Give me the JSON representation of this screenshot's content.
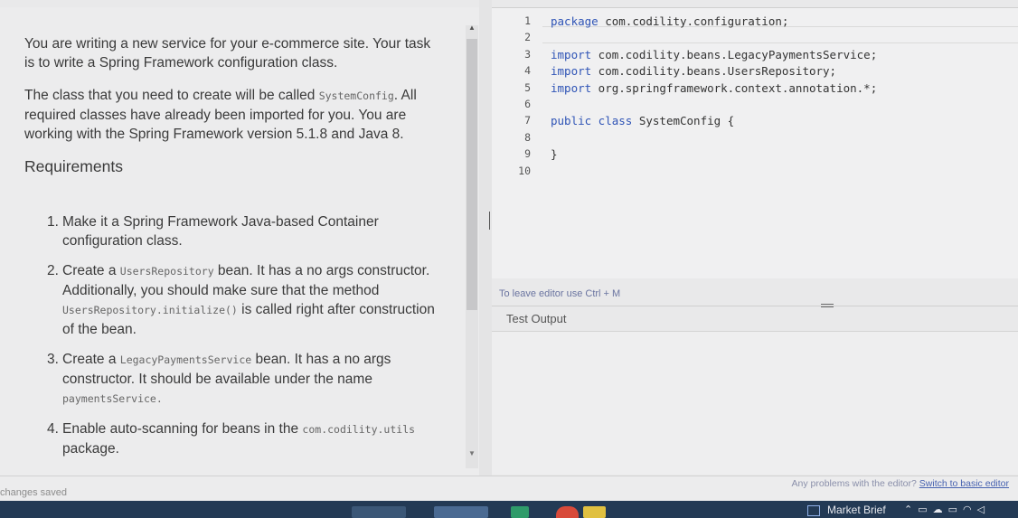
{
  "task": {
    "intro_line1": "You are writing a new service for your e-commerce site. Your task",
    "intro_line2": "is to write a Spring Framework configuration class.",
    "class_line1_pre": "The class that you need to create will be called ",
    "class_name": "SystemConfig",
    "class_line1_post": ". All",
    "class_line2": "required classes have already been imported for you. You are",
    "class_line3": "working with the Spring Framework version 5.1.8 and Java 8.",
    "requirements_title": "Requirements",
    "requirements": [
      {
        "num": "1.",
        "line1": "Make it a Spring Framework Java-based Container",
        "line2": "configuration class."
      },
      {
        "num": "2.",
        "line1_pre": "Create a ",
        "line1_code": "UsersRepository",
        "line1_post": " bean. It has a no args constructor.",
        "line2": "Additionally, you should make sure that the method",
        "line3_code": "UsersRepository.initialize()",
        "line3_post": " is called right after construction",
        "line4": "of the bean."
      },
      {
        "num": "3.",
        "line1_pre": "Create a ",
        "line1_code": "LegacyPaymentsService",
        "line1_post": " bean. It has a no args",
        "line2": "constructor. It should be available under the name",
        "line3_code": "paymentsService."
      },
      {
        "num": "4.",
        "line1_pre": "Enable auto-scanning for beans in the ",
        "line1_code": "com.codility.utils",
        "line2": "package."
      }
    ]
  },
  "editor": {
    "line_numbers": [
      "1",
      "2",
      "3",
      "4",
      "5",
      "6",
      "7",
      "8",
      "9",
      "10"
    ],
    "lines": [
      {
        "kw": "package",
        "rest": " com.codility.configuration;"
      },
      {
        "kw": "",
        "rest": ""
      },
      {
        "kw": "import",
        "rest": " com.codility.beans.LegacyPaymentsService;"
      },
      {
        "kw": "import",
        "rest": " com.codility.beans.UsersRepository;"
      },
      {
        "kw": "import",
        "rest": " org.springframework.context.annotation.*;"
      },
      {
        "kw": "",
        "rest": ""
      },
      {
        "kw": "public class",
        "rest": " SystemConfig {"
      },
      {
        "kw": "",
        "rest": ""
      },
      {
        "kw": "",
        "rest": "}"
      },
      {
        "kw": "",
        "rest": ""
      }
    ],
    "hint": "To leave editor use Ctrl + M",
    "output_tab": "Test Output"
  },
  "footer": {
    "status": "changes saved",
    "problems_text": "Any problems with the editor? ",
    "problems_link": "Switch to basic editor"
  },
  "taskbar": {
    "market_label": "Market Brief",
    "tray_icons": [
      "chevron-up-icon",
      "tablet-icon",
      "cloud-icon",
      "battery-icon",
      "wifi-icon",
      "speaker-icon"
    ]
  },
  "colors": {
    "keyword": "#2f54b6",
    "taskbar": "#233a55",
    "link": "#4762b0"
  }
}
